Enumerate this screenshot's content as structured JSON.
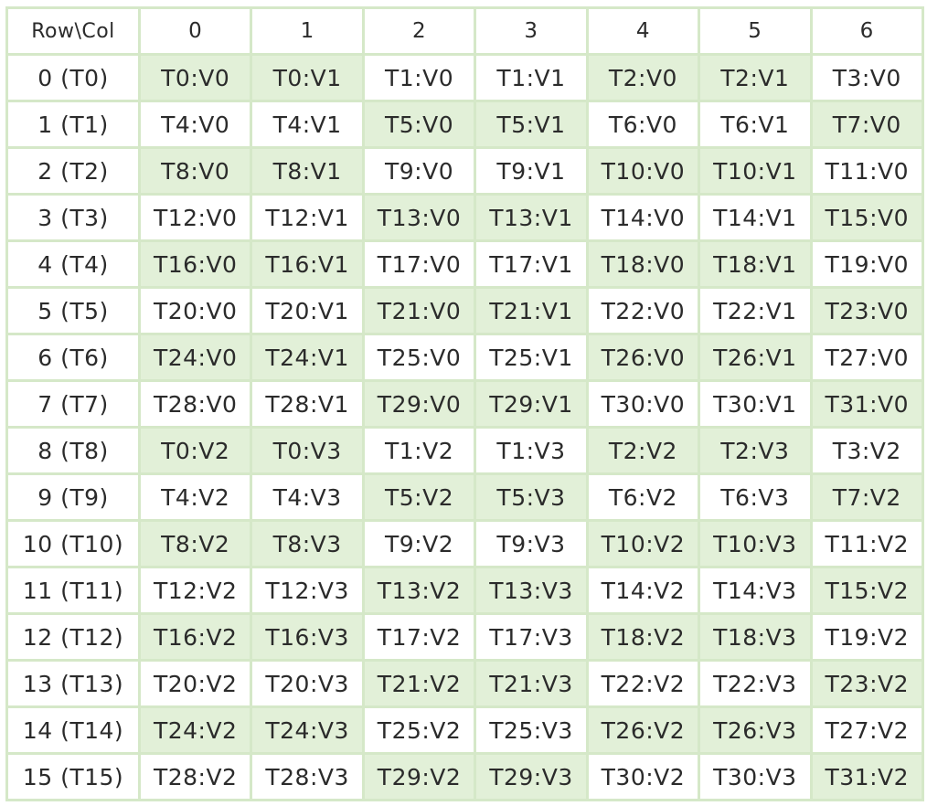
{
  "colors": {
    "grid_line": "#d5e8c8",
    "shaded_fill": "#e2f0d8",
    "plain_fill": "#ffffff",
    "text": "#2b2b2b"
  },
  "table": {
    "corner": "Row\\Col",
    "columns": [
      "0",
      "1",
      "2",
      "3",
      "4",
      "5",
      "6"
    ],
    "rows": [
      {
        "label": "0 (T0)",
        "cells": [
          "T0:V0",
          "T0:V1",
          "T1:V0",
          "T1:V1",
          "T2:V0",
          "T2:V1",
          "T3:V0"
        ],
        "shaded": [
          1,
          1,
          0,
          0,
          1,
          1,
          0
        ]
      },
      {
        "label": "1 (T1)",
        "cells": [
          "T4:V0",
          "T4:V1",
          "T5:V0",
          "T5:V1",
          "T6:V0",
          "T6:V1",
          "T7:V0"
        ],
        "shaded": [
          0,
          0,
          1,
          1,
          0,
          0,
          1
        ]
      },
      {
        "label": "2 (T2)",
        "cells": [
          "T8:V0",
          "T8:V1",
          "T9:V0",
          "T9:V1",
          "T10:V0",
          "T10:V1",
          "T11:V0"
        ],
        "shaded": [
          1,
          1,
          0,
          0,
          1,
          1,
          0
        ]
      },
      {
        "label": "3 (T3)",
        "cells": [
          "T12:V0",
          "T12:V1",
          "T13:V0",
          "T13:V1",
          "T14:V0",
          "T14:V1",
          "T15:V0"
        ],
        "shaded": [
          0,
          0,
          1,
          1,
          0,
          0,
          1
        ]
      },
      {
        "label": "4 (T4)",
        "cells": [
          "T16:V0",
          "T16:V1",
          "T17:V0",
          "T17:V1",
          "T18:V0",
          "T18:V1",
          "T19:V0"
        ],
        "shaded": [
          1,
          1,
          0,
          0,
          1,
          1,
          0
        ]
      },
      {
        "label": "5 (T5)",
        "cells": [
          "T20:V0",
          "T20:V1",
          "T21:V0",
          "T21:V1",
          "T22:V0",
          "T22:V1",
          "T23:V0"
        ],
        "shaded": [
          0,
          0,
          1,
          1,
          0,
          0,
          1
        ]
      },
      {
        "label": "6 (T6)",
        "cells": [
          "T24:V0",
          "T24:V1",
          "T25:V0",
          "T25:V1",
          "T26:V0",
          "T26:V1",
          "T27:V0"
        ],
        "shaded": [
          1,
          1,
          0,
          0,
          1,
          1,
          0
        ]
      },
      {
        "label": "7 (T7)",
        "cells": [
          "T28:V0",
          "T28:V1",
          "T29:V0",
          "T29:V1",
          "T30:V0",
          "T30:V1",
          "T31:V0"
        ],
        "shaded": [
          0,
          0,
          1,
          1,
          0,
          0,
          1
        ]
      },
      {
        "label": "8 (T8)",
        "cells": [
          "T0:V2",
          "T0:V3",
          "T1:V2",
          "T1:V3",
          "T2:V2",
          "T2:V3",
          "T3:V2"
        ],
        "shaded": [
          1,
          1,
          0,
          0,
          1,
          1,
          0
        ]
      },
      {
        "label": "9 (T9)",
        "cells": [
          "T4:V2",
          "T4:V3",
          "T5:V2",
          "T5:V3",
          "T6:V2",
          "T6:V3",
          "T7:V2"
        ],
        "shaded": [
          0,
          0,
          1,
          1,
          0,
          0,
          1
        ]
      },
      {
        "label": "10 (T10)",
        "cells": [
          "T8:V2",
          "T8:V3",
          "T9:V2",
          "T9:V3",
          "T10:V2",
          "T10:V3",
          "T11:V2"
        ],
        "shaded": [
          1,
          1,
          0,
          0,
          1,
          1,
          0
        ]
      },
      {
        "label": "11 (T11)",
        "cells": [
          "T12:V2",
          "T12:V3",
          "T13:V2",
          "T13:V3",
          "T14:V2",
          "T14:V3",
          "T15:V2"
        ],
        "shaded": [
          0,
          0,
          1,
          1,
          0,
          0,
          1
        ]
      },
      {
        "label": "12 (T12)",
        "cells": [
          "T16:V2",
          "T16:V3",
          "T17:V2",
          "T17:V3",
          "T18:V2",
          "T18:V3",
          "T19:V2"
        ],
        "shaded": [
          1,
          1,
          0,
          0,
          1,
          1,
          0
        ]
      },
      {
        "label": "13 (T13)",
        "cells": [
          "T20:V2",
          "T20:V3",
          "T21:V2",
          "T21:V3",
          "T22:V2",
          "T22:V3",
          "T23:V2"
        ],
        "shaded": [
          0,
          0,
          1,
          1,
          0,
          0,
          1
        ]
      },
      {
        "label": "14 (T14)",
        "cells": [
          "T24:V2",
          "T24:V3",
          "T25:V2",
          "T25:V3",
          "T26:V2",
          "T26:V3",
          "T27:V2"
        ],
        "shaded": [
          1,
          1,
          0,
          0,
          1,
          1,
          0
        ]
      },
      {
        "label": "15 (T15)",
        "cells": [
          "T28:V2",
          "T28:V3",
          "T29:V2",
          "T29:V3",
          "T30:V2",
          "T30:V3",
          "T31:V2"
        ],
        "shaded": [
          0,
          0,
          1,
          1,
          0,
          0,
          1
        ]
      }
    ]
  }
}
